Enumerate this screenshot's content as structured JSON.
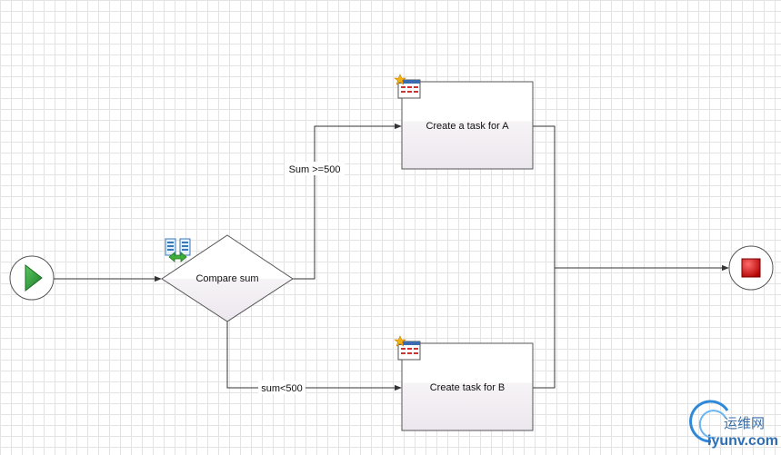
{
  "nodes": {
    "start": {
      "shape": "circle",
      "color": "#2e9b3b"
    },
    "decision": {
      "label": "Compare sum"
    },
    "task_a": {
      "label": "Create a task for A"
    },
    "task_b": {
      "label": "Create task for B"
    },
    "end": {
      "shape": "circle",
      "color": "#cc1111"
    }
  },
  "edges": {
    "to_a_label": "Sum >=500",
    "to_b_label": "sum<500"
  },
  "watermark": {
    "text": "运维网",
    "url": "iyunv.com"
  }
}
